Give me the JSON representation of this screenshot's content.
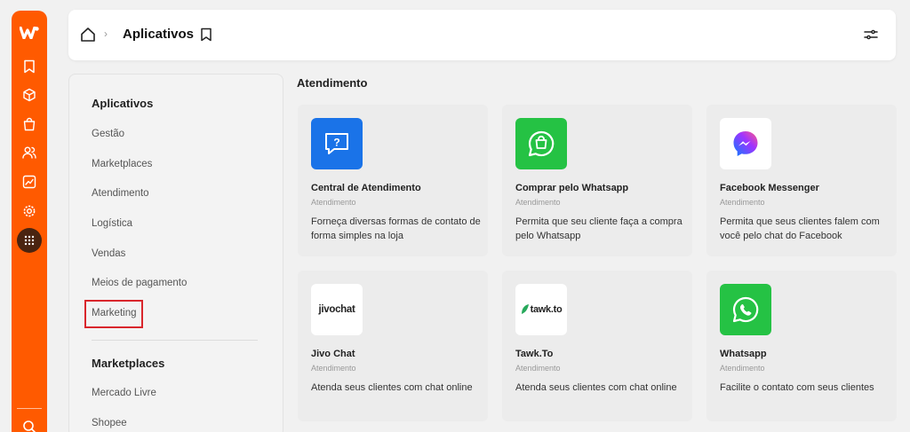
{
  "header": {
    "title": "Aplicativos",
    "separator": "›"
  },
  "sidebar": {
    "sections": [
      {
        "title": "Aplicativos",
        "items": [
          "Gestão",
          "Marketplaces",
          "Atendimento",
          "Logística",
          "Vendas",
          "Meios de pagamento",
          "Marketing"
        ]
      },
      {
        "title": "Marketplaces",
        "items": [
          "Mercado Livre",
          "Shopee"
        ]
      }
    ],
    "highlighted_item": "Marketing"
  },
  "main": {
    "section_title": "Atendimento",
    "cards": [
      {
        "name": "Central de Atendimento",
        "category": "Atendimento",
        "description": "Forneça diversas formas de contato de forma simples na loja",
        "icon": "question-chat-icon",
        "icon_bg": "#1a73e8"
      },
      {
        "name": "Comprar pelo Whatsapp",
        "category": "Atendimento",
        "description": "Permita que seu cliente faça a compra pelo Whatsapp",
        "icon": "whatsapp-bag-icon",
        "icon_bg": "#25c244"
      },
      {
        "name": "Facebook Messenger",
        "category": "Atendimento",
        "description": "Permita que seus clientes falem com você pelo chat do Facebook",
        "icon": "messenger-icon",
        "icon_bg": "#ffffff"
      },
      {
        "name": "Jivo Chat",
        "category": "Atendimento",
        "description": "Atenda seus clientes com chat online",
        "icon": "jivochat-logo",
        "icon_bg": "#ffffff",
        "logo_text": "jivochat"
      },
      {
        "name": "Tawk.To",
        "category": "Atendimento",
        "description": "Atenda seus clientes com chat online",
        "icon": "tawkto-logo",
        "icon_bg": "#ffffff",
        "logo_text": "tawk.to"
      },
      {
        "name": "Whatsapp",
        "category": "Atendimento",
        "description": "Facilite o contato com seus clientes",
        "icon": "whatsapp-icon",
        "icon_bg": "#25c244"
      }
    ]
  },
  "rail": {
    "icons": [
      "bookmark-icon",
      "box-icon",
      "bag-icon",
      "users-icon",
      "chart-icon",
      "gear-icon",
      "apps-grid-icon",
      "search-icon"
    ]
  },
  "colors": {
    "brand": "#ff5a00",
    "highlight": "#d9262c",
    "card_bg": "#ececec"
  }
}
